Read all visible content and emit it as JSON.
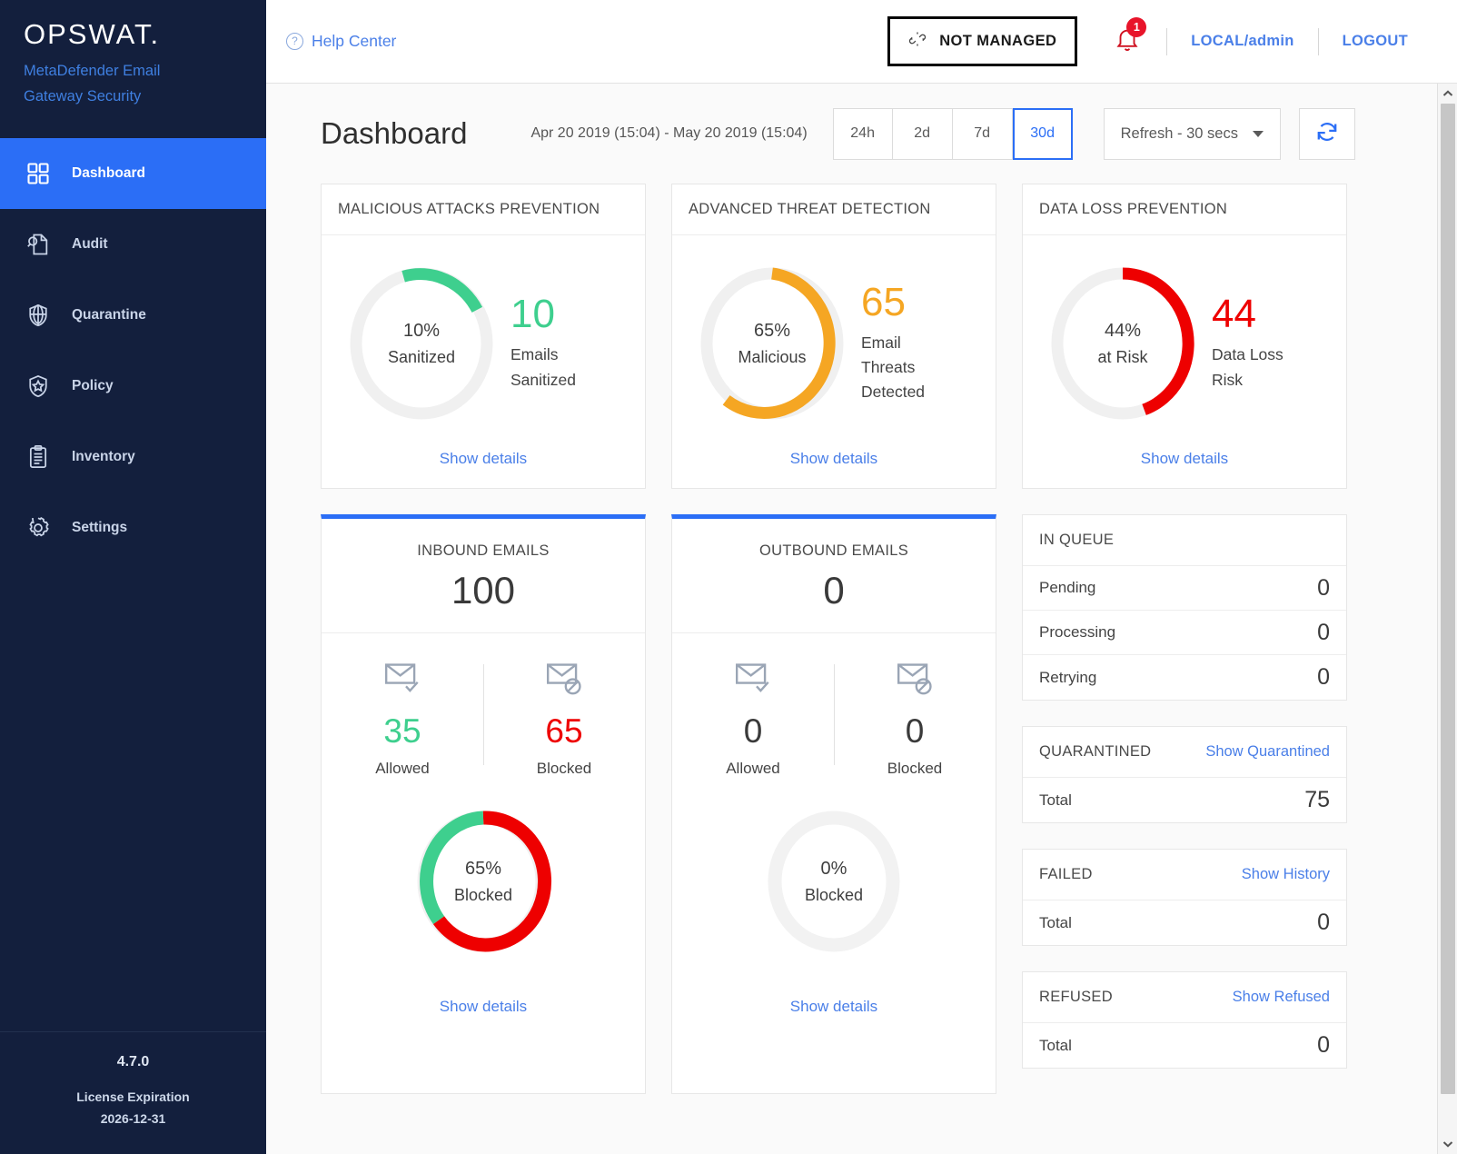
{
  "sidebar": {
    "logo": "OPSWAT.",
    "product_line1": "MetaDefender Email",
    "product_line2": "Gateway Security",
    "items": [
      {
        "label": "Dashboard",
        "icon": "grid-icon"
      },
      {
        "label": "Audit",
        "icon": "audit-icon"
      },
      {
        "label": "Quarantine",
        "icon": "shield-globe-icon"
      },
      {
        "label": "Policy",
        "icon": "shield-star-icon"
      },
      {
        "label": "Inventory",
        "icon": "clipboard-icon"
      },
      {
        "label": "Settings",
        "icon": "gear-icon"
      }
    ],
    "footer": {
      "version": "4.7.0",
      "license_label": "License Expiration",
      "license_date": "2026-12-31"
    }
  },
  "topbar": {
    "help_center": "Help Center",
    "managed_status": "NOT MANAGED",
    "notification_count": "1",
    "user": "LOCAL/admin",
    "logout": "LOGOUT"
  },
  "page": {
    "title": "Dashboard",
    "date_range": "Apr 20 2019 (15:04) - May 20 2019 (15:04)",
    "ranges": [
      {
        "label": "24h",
        "active": false
      },
      {
        "label": "2d",
        "active": false
      },
      {
        "label": "7d",
        "active": false
      },
      {
        "label": "30d",
        "active": true
      }
    ],
    "refresh_select": "Refresh - 30 secs",
    "refresh_button": "refresh-icon"
  },
  "colors": {
    "accent": "#2b6ef6",
    "green": "#3ecf8e",
    "orange": "#f5a623",
    "red": "#ee0000",
    "track": "#f0f0f0",
    "link": "#4a7fe8"
  },
  "cards": [
    {
      "title": "MALICIOUS ATTACKS PREVENTION",
      "percent_value": "10%",
      "percent_label": "Sanitized",
      "big_number": "10",
      "big_label_line1": "Emails",
      "big_label_line2": "Sanitized",
      "color": "#3ecf8e",
      "show_details": "Show details"
    },
    {
      "title": "ADVANCED THREAT DETECTION",
      "percent_value": "65%",
      "percent_label": "Malicious",
      "big_number": "65",
      "big_label_line1": "Email",
      "big_label_line2": "Threats",
      "big_label_line3": "Detected",
      "color": "#f5a623",
      "show_details": "Show details"
    },
    {
      "title": "DATA LOSS PREVENTION",
      "percent_value": "44%",
      "percent_label": "at Risk",
      "big_number": "44",
      "big_label_line1": "Data Loss",
      "big_label_line2": "Risk",
      "color": "#ee0000",
      "show_details": "Show details"
    }
  ],
  "email_cards": [
    {
      "title": "INBOUND EMAILS",
      "total": "100",
      "allowed_value": "35",
      "allowed_label": "Allowed",
      "blocked_value": "65",
      "blocked_label": "Blocked",
      "donut_percent": "65%",
      "donut_label": "Blocked",
      "show_details": "Show details"
    },
    {
      "title": "OUTBOUND EMAILS",
      "total": "0",
      "allowed_value": "0",
      "allowed_label": "Allowed",
      "blocked_value": "0",
      "blocked_label": "Blocked",
      "donut_percent": "0%",
      "donut_label": "Blocked",
      "show_details": "Show details"
    }
  ],
  "panels": {
    "in_queue": {
      "title": "IN QUEUE",
      "rows": [
        {
          "label": "Pending",
          "value": "0"
        },
        {
          "label": "Processing",
          "value": "0"
        },
        {
          "label": "Retrying",
          "value": "0"
        }
      ]
    },
    "quarantined": {
      "title": "QUARANTINED",
      "link": "Show Quarantined",
      "rows": [
        {
          "label": "Total",
          "value": "75"
        }
      ]
    },
    "failed": {
      "title": "FAILED",
      "link": "Show History",
      "rows": [
        {
          "label": "Total",
          "value": "0"
        }
      ]
    },
    "refused": {
      "title": "REFUSED",
      "link": "Show Refused",
      "rows": [
        {
          "label": "Total",
          "value": "0"
        }
      ]
    }
  },
  "chart_data": [
    {
      "type": "pie",
      "title": "MALICIOUS ATTACKS PREVENTION",
      "labels": [
        "Sanitized",
        "Remaining"
      ],
      "values": [
        10,
        90
      ],
      "display_value": "10%",
      "display_label": "Sanitized",
      "colors": [
        "#3ecf8e",
        "#f0f0f0"
      ]
    },
    {
      "type": "pie",
      "title": "ADVANCED THREAT DETECTION",
      "labels": [
        "Malicious",
        "Remaining"
      ],
      "values": [
        65,
        35
      ],
      "display_value": "65%",
      "display_label": "Malicious",
      "colors": [
        "#f5a623",
        "#f0f0f0"
      ]
    },
    {
      "type": "pie",
      "title": "DATA LOSS PREVENTION",
      "labels": [
        "at Risk",
        "Remaining"
      ],
      "values": [
        44,
        56
      ],
      "display_value": "44%",
      "display_label": "at Risk",
      "colors": [
        "#ee0000",
        "#f0f0f0"
      ]
    },
    {
      "type": "pie",
      "title": "INBOUND EMAILS",
      "labels": [
        "Blocked",
        "Allowed"
      ],
      "values": [
        65,
        35
      ],
      "display_value": "65%",
      "display_label": "Blocked",
      "colors": [
        "#ee0000",
        "#3ecf8e"
      ]
    },
    {
      "type": "pie",
      "title": "OUTBOUND EMAILS",
      "labels": [
        "Blocked",
        "Allowed"
      ],
      "values": [
        0,
        100
      ],
      "display_value": "0%",
      "display_label": "Blocked",
      "colors": [
        "#ee0000",
        "#f0f0f0"
      ]
    }
  ]
}
